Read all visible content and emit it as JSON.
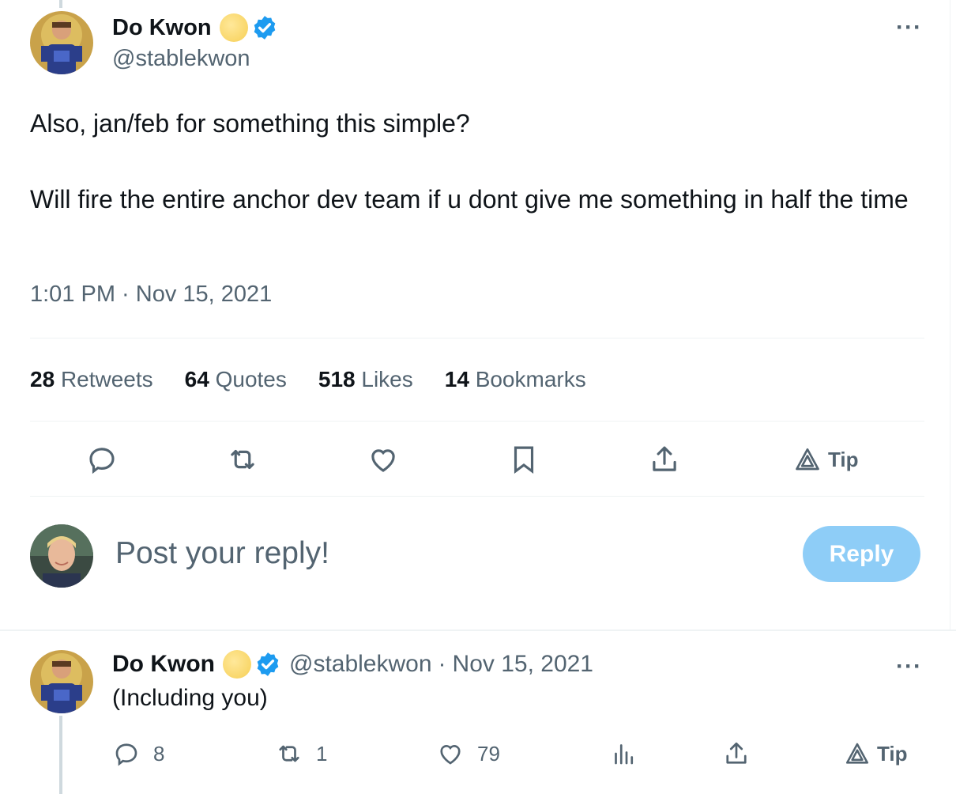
{
  "tweet": {
    "author_name": "Do Kwon",
    "author_handle": "@stablekwon",
    "text_line1": "Also, jan/feb for something this simple?",
    "text_line2": "Will fire the entire anchor dev team if u dont give me something in half the time",
    "timestamp": "1:01 PM · Nov 15, 2021",
    "more_label": "···",
    "stats": [
      {
        "count": "28",
        "label": "Retweets"
      },
      {
        "count": "64",
        "label": "Quotes"
      },
      {
        "count": "518",
        "label": "Likes"
      },
      {
        "count": "14",
        "label": "Bookmarks"
      }
    ],
    "actions": {
      "tip_label": "Tip"
    }
  },
  "reply_composer": {
    "placeholder": "Post your reply!",
    "button_label": "Reply"
  },
  "reply": {
    "author_name": "Do Kwon",
    "author_handle": "@stablekwon",
    "separator": "·",
    "date": "Nov 15, 2021",
    "text": "(Including you)",
    "more_label": "···",
    "actions": {
      "replies": "8",
      "retweets": "1",
      "likes": "79",
      "tip_label": "Tip"
    }
  },
  "colors": {
    "accent": "#1d9bf0",
    "reply_button": "#8ecdf7",
    "secondary_text": "#536471"
  },
  "icons": [
    "coin-badge-icon",
    "verified-icon",
    "more-icon",
    "reply-icon",
    "retweet-icon",
    "like-icon",
    "bookmark-icon",
    "share-icon",
    "tip-icon",
    "views-icon"
  ]
}
